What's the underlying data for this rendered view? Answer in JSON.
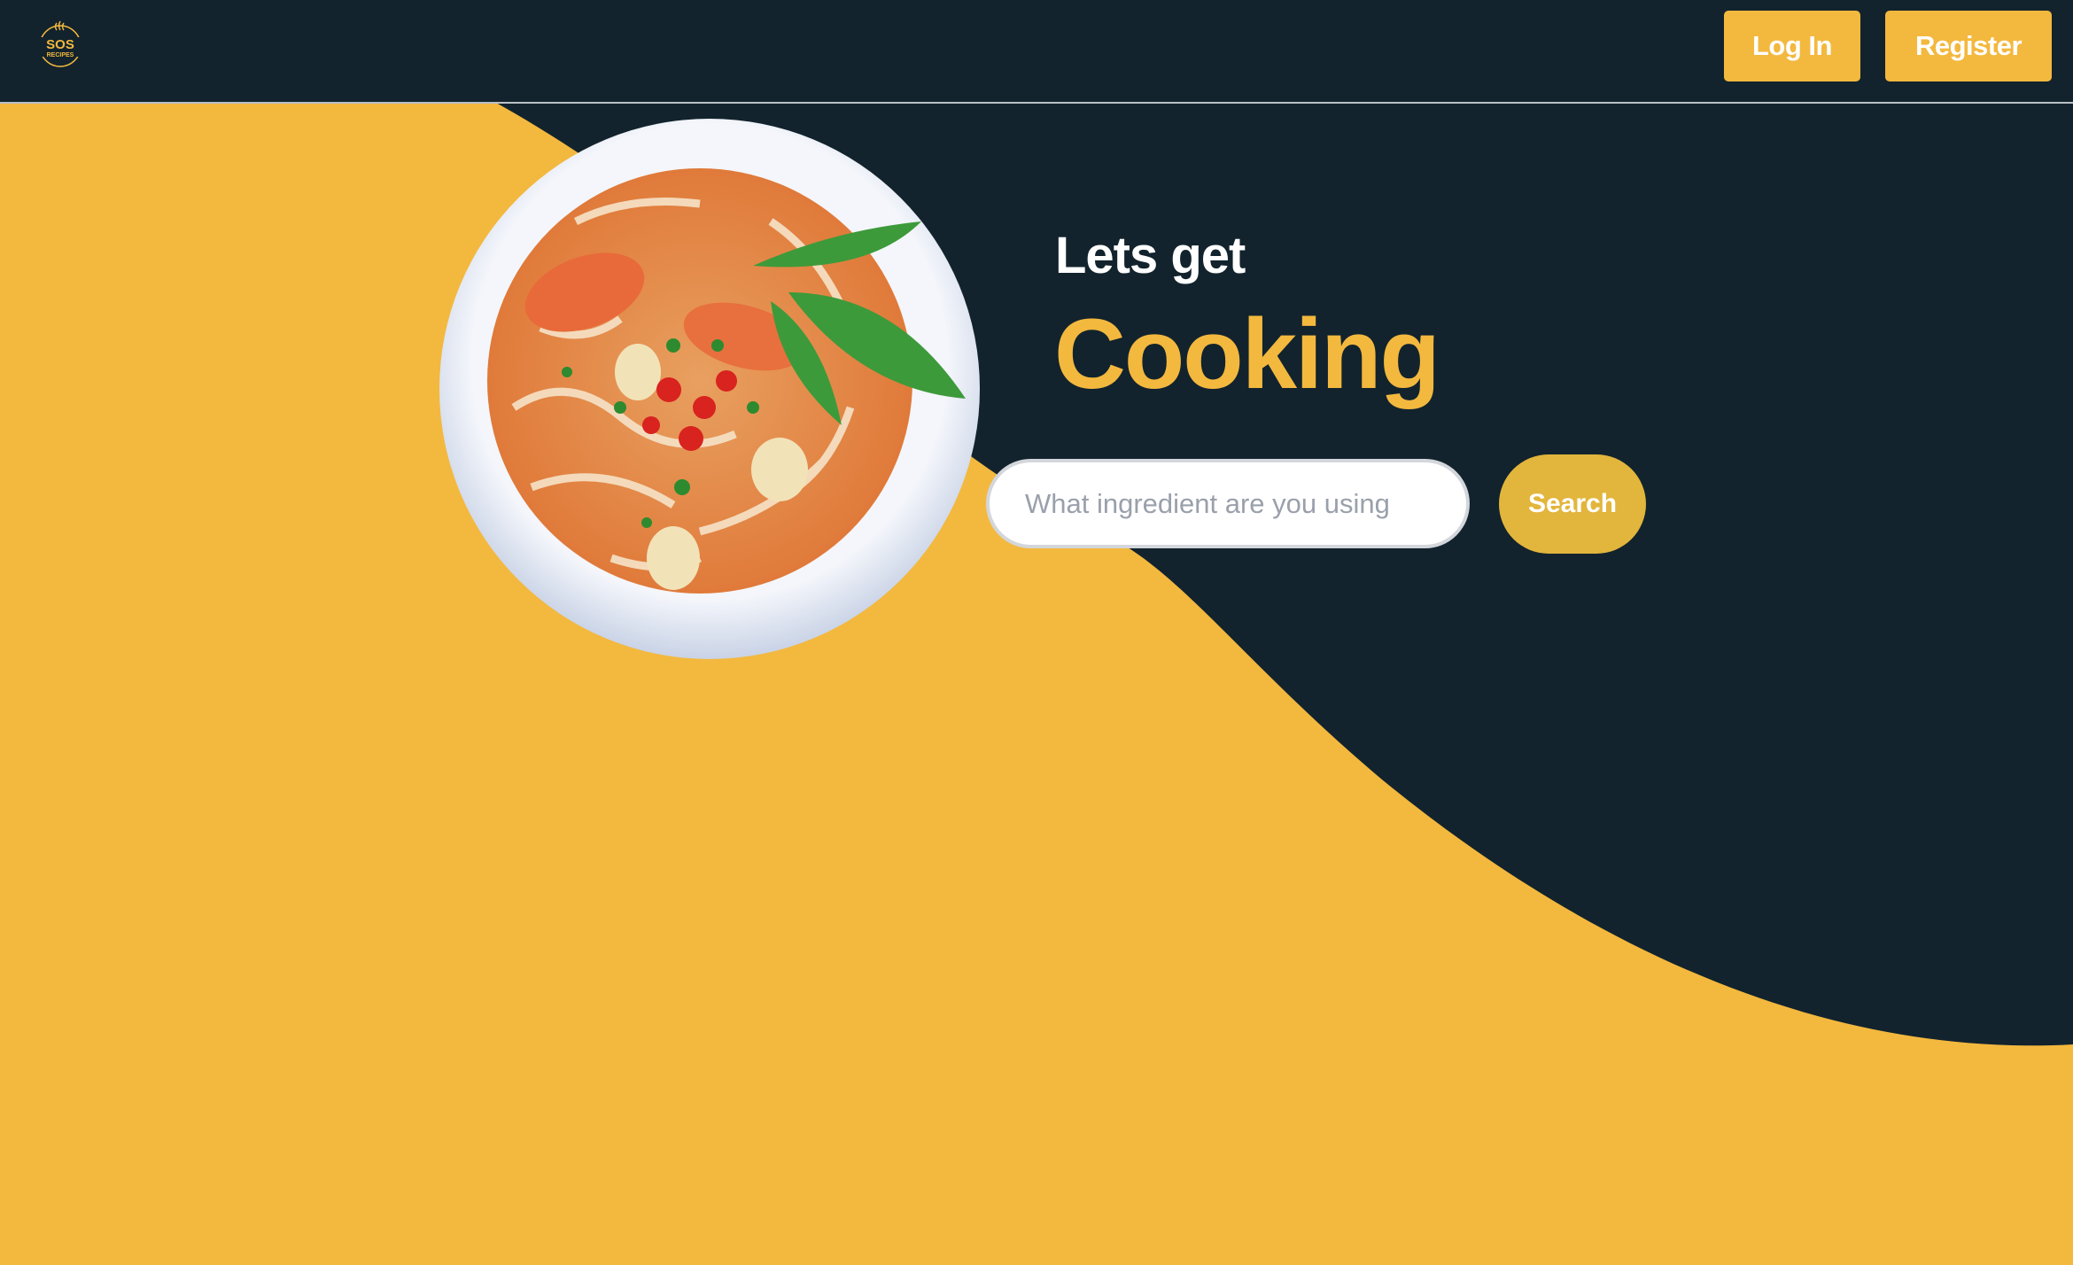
{
  "brand": {
    "logo_line1": "SOS",
    "logo_line2": "RECIPES"
  },
  "nav": {
    "login_label": "Log In",
    "register_label": "Register"
  },
  "hero": {
    "line1": "Lets get",
    "line2": "Cooking"
  },
  "search": {
    "placeholder": "What ingredient are you using",
    "button_label": "Search"
  },
  "colors": {
    "accent": "#f3b83e",
    "dark": "#12232d",
    "search_button": "#e2b53c"
  }
}
